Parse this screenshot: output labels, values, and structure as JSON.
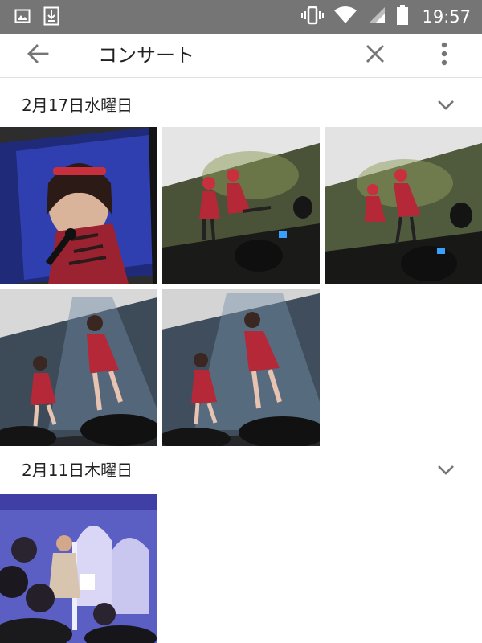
{
  "status_bar": {
    "icons_left": [
      "gallery-icon",
      "download-icon"
    ],
    "icons_right": [
      "vibrate-icon",
      "wifi-icon",
      "cellular-signal-icon",
      "battery-icon"
    ],
    "time": "19:57",
    "background": "#757575"
  },
  "toolbar": {
    "title": "コンサート",
    "back_icon": "arrow-back-icon",
    "clear_icon": "close-icon",
    "menu_icon": "more-vert-icon"
  },
  "sections": [
    {
      "title": "2月17日水曜日",
      "toggle_icon": "chevron-down-icon",
      "photo_count": 5,
      "photos": [
        "concert-photo-singer-closeup",
        "concert-photo-duo-stage-1",
        "concert-photo-duo-stage-2",
        "concert-photo-duo-stage-3",
        "concert-photo-duo-stage-4"
      ]
    },
    {
      "title": "2月11日木曜日",
      "toggle_icon": "chevron-down-icon",
      "photo_count": 1,
      "photos": [
        "event-photo-hall-stage"
      ]
    }
  ],
  "colors": {
    "text_primary": "#212121",
    "icon_gray": "#757575",
    "divider": "#e2e2e2"
  }
}
